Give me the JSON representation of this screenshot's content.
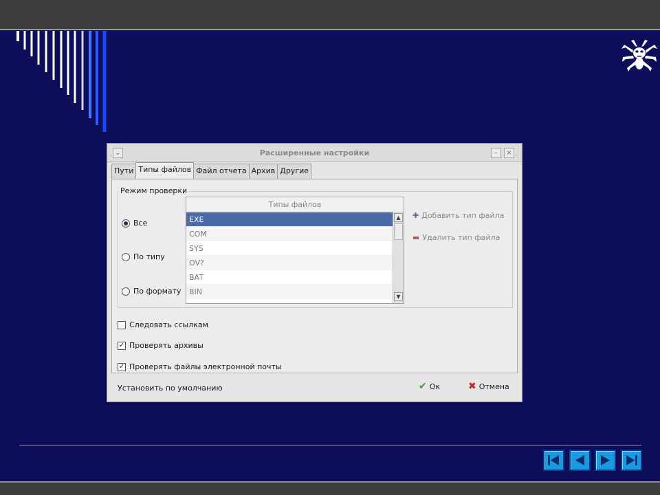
{
  "dialog": {
    "title": "Расширенные настройки",
    "menu_glyph": "⌄",
    "minimize_glyph": "–",
    "close_glyph": "×"
  },
  "tabs": [
    {
      "label": "Пути",
      "active": false
    },
    {
      "label": "Типы файлов",
      "active": true
    },
    {
      "label": "Файл отчета",
      "active": false
    },
    {
      "label": "Архив",
      "active": false
    },
    {
      "label": "Другие",
      "active": false
    }
  ],
  "scan_mode": {
    "label": "Режим проверки",
    "options": [
      {
        "label": "Все",
        "selected": true
      },
      {
        "label": "По типу",
        "selected": false
      },
      {
        "label": "По формату",
        "selected": false
      }
    ]
  },
  "file_types": {
    "header": "Типы файлов",
    "items": [
      "EXE",
      "COM",
      "SYS",
      "OV?",
      "BAT",
      "BIN"
    ],
    "selected": "EXE"
  },
  "side_buttons": {
    "add_label": "Добавить тип файла",
    "remove_label": "Удалить тип файла"
  },
  "options": [
    {
      "label": "Следовать ссылкам",
      "checked": false
    },
    {
      "label": "Проверять архивы",
      "checked": true
    },
    {
      "label": "Проверять файлы электронной почты",
      "checked": true
    }
  ],
  "footer": {
    "default_label": "Установить по умолчанию",
    "ok_label": "Ок",
    "cancel_label": "Отмена"
  },
  "colors": {
    "slide_background": "#0d0d5a",
    "nav_button": "#1a9ae0",
    "selection": "#4b6aa8"
  },
  "icons": [
    "drweb-spider-logo-icon",
    "first-slide-icon",
    "previous-slide-icon",
    "next-slide-icon",
    "last-slide-icon",
    "plus-icon",
    "minus-icon",
    "checkmark-icon",
    "cross-icon"
  ]
}
